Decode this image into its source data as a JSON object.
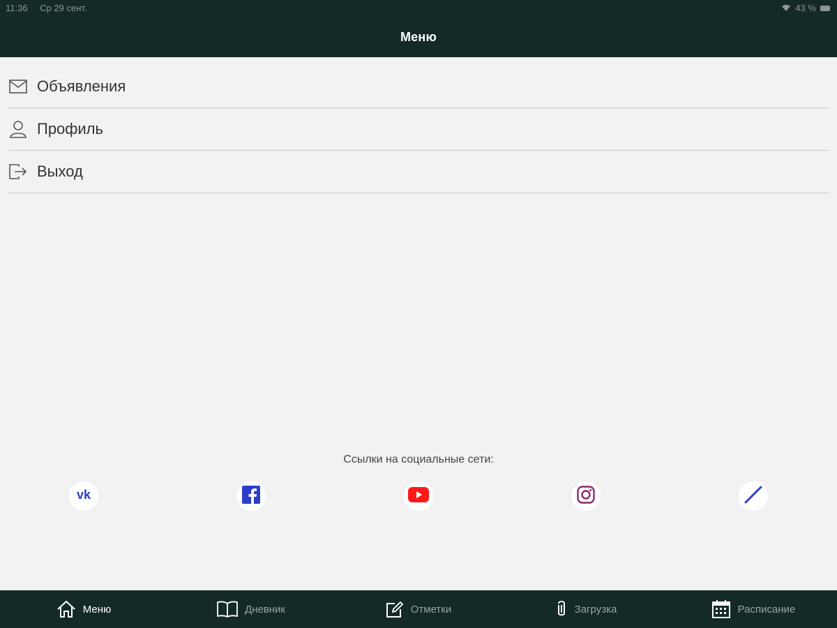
{
  "status_bar": {
    "time": "11:36",
    "date": "Ср 29 сент.",
    "battery": "43 %"
  },
  "nav": {
    "title": "Меню"
  },
  "menu": {
    "items": [
      {
        "label": "Объявления",
        "icon": "envelope-icon"
      },
      {
        "label": "Профиль",
        "icon": "person-icon"
      },
      {
        "label": "Выход",
        "icon": "logout-icon"
      }
    ]
  },
  "social": {
    "title": "Ссылки на социальные сети:",
    "links": [
      {
        "icon": "vk-icon",
        "color": "#2d3ec9"
      },
      {
        "icon": "facebook-icon",
        "color": "#2d3ec9"
      },
      {
        "icon": "youtube-icon",
        "color": "#ff1a1a"
      },
      {
        "icon": "instagram-icon",
        "color": "#8a2b6b"
      },
      {
        "icon": "link-slash-icon",
        "color": "#2d3ec9"
      }
    ]
  },
  "tabs": [
    {
      "label": "Меню",
      "icon": "home-icon",
      "active": true
    },
    {
      "label": "Дневник",
      "icon": "book-icon",
      "active": false
    },
    {
      "label": "Отметки",
      "icon": "edit-icon",
      "active": false
    },
    {
      "label": "Загрузка",
      "icon": "paperclip-icon",
      "active": false
    },
    {
      "label": "Расписание",
      "icon": "calendar-icon",
      "active": false
    }
  ],
  "colors": {
    "header_bg": "#142a28",
    "page_bg": "#f2f2f2",
    "divider": "#c8c8c8"
  }
}
